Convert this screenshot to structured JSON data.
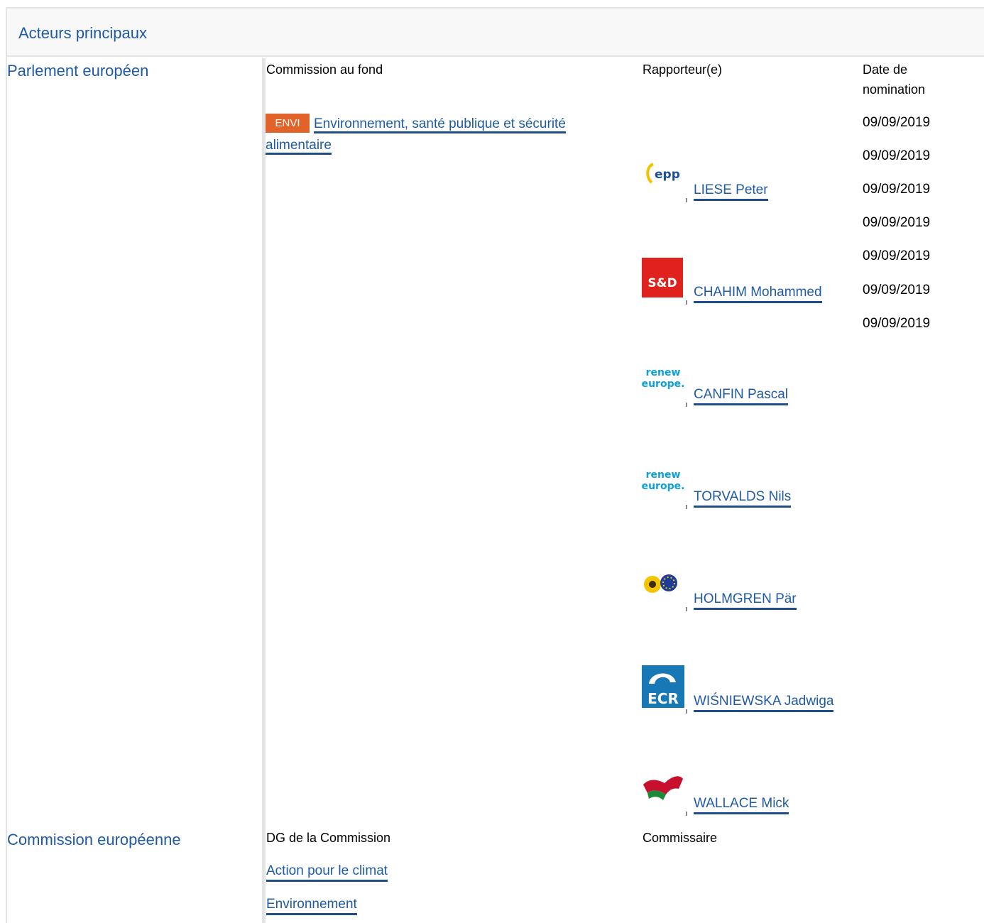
{
  "section_title": "Acteurs principaux",
  "parliament": {
    "label": "Parlement européen",
    "col_committee": "Commission au fond",
    "col_rapporteur": "Rapporteur(e)",
    "col_date": "Date de nomination",
    "committee": {
      "badge": "ENVI",
      "name": "Environnement, santé publique et sécurité alimentaire"
    },
    "rapporteurs": [
      {
        "name": "LIESE Peter",
        "group_icon": "epp-logo-icon"
      },
      {
        "name": "CHAHIM Mohammed",
        "group_icon": "sd-logo-icon",
        "logo_text": "S&D"
      },
      {
        "name": "CANFIN Pascal",
        "group_icon": "renew-europe-logo-icon",
        "logo_text": "renew europe."
      },
      {
        "name": "TORVALDS Nils",
        "group_icon": "renew-europe-logo-icon",
        "logo_text": "renew europe."
      },
      {
        "name": "HOLMGREN Pär",
        "group_icon": "greens-efa-logo-icon"
      },
      {
        "name": "WIŚNIEWSKA Jadwiga",
        "group_icon": "ecr-logo-icon",
        "logo_text": "ECR"
      },
      {
        "name": "WALLACE Mick",
        "group_icon": "gue-ngl-logo-icon"
      }
    ],
    "dates": [
      "09/09/2019",
      "09/09/2019",
      "09/09/2019",
      "09/09/2019",
      "09/09/2019",
      "09/09/2019",
      "09/09/2019"
    ]
  },
  "commission": {
    "label": "Commission européenne",
    "col_dg": "DG de la Commission",
    "col_commissioner": "Commissaire",
    "dgs": [
      "Action pour le climat",
      "Environnement"
    ]
  },
  "colors": {
    "link": "#1f5aa6",
    "link_underline": "#1f4f86",
    "badge": "#e2632a",
    "header_bg": "#f8f8f8",
    "divider": "#e4e4e4"
  }
}
